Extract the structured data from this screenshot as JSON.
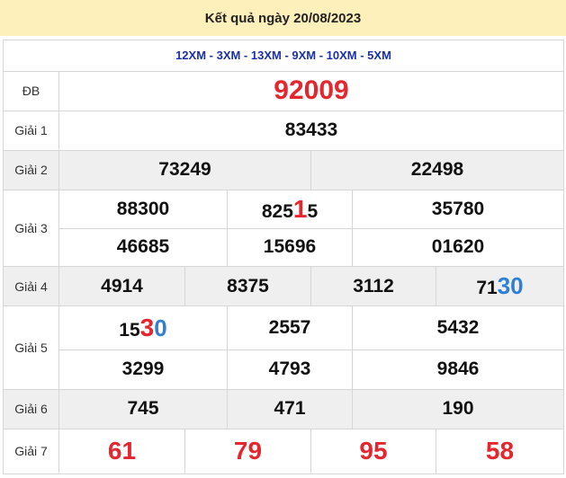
{
  "header": {
    "title": "Kết quả ngày 20/08/2023"
  },
  "codes": "12XM - 3XM - 13XM - 9XM - 10XM - 5XM",
  "labels": {
    "db": "ĐB",
    "g1": "Giải 1",
    "g2": "Giải 2",
    "g3": "Giải 3",
    "g4": "Giải 4",
    "g5": "Giải 5",
    "g6": "Giải 6",
    "g7": "Giải 7"
  },
  "prizes": {
    "db": "92009",
    "g1": "83433",
    "g2": [
      "73249",
      "22498"
    ],
    "g3": [
      {
        "pre": "88300",
        "hl": "",
        "post": ""
      },
      {
        "pre": "825",
        "hl": "1",
        "post": "5"
      },
      {
        "pre": "35780",
        "hl": "",
        "post": ""
      },
      {
        "pre": "46685",
        "hl": "",
        "post": ""
      },
      {
        "pre": "15696",
        "hl": "",
        "post": ""
      },
      {
        "pre": "01620",
        "hl": "",
        "post": ""
      }
    ],
    "g4": [
      {
        "pre": "4914",
        "hl": ""
      },
      {
        "pre": "8375",
        "hl": ""
      },
      {
        "pre": "3112",
        "hl": ""
      },
      {
        "pre": "71",
        "hl": "30"
      }
    ],
    "g5": [
      {
        "pre": "15",
        "hl1": "3",
        "hl2": "0"
      },
      {
        "pre": "2557",
        "hl1": "",
        "hl2": ""
      },
      {
        "pre": "5432",
        "hl1": "",
        "hl2": ""
      },
      {
        "pre": "3299",
        "hl1": "",
        "hl2": ""
      },
      {
        "pre": "4793",
        "hl1": "",
        "hl2": ""
      },
      {
        "pre": "9846",
        "hl1": "",
        "hl2": ""
      }
    ],
    "g6": [
      "745",
      "471",
      "190"
    ],
    "g7": [
      "61",
      "79",
      "95",
      "58"
    ]
  },
  "colors": {
    "header_bg": "#fdf0bb",
    "red": "#e4262f",
    "blue": "#2f7fd6",
    "codes": "#1a2fb0"
  }
}
